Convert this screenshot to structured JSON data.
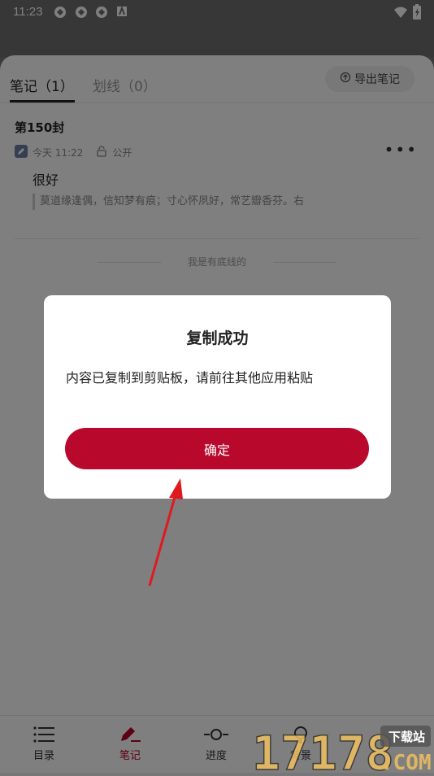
{
  "status": {
    "time": "11:23"
  },
  "tabs": [
    {
      "label": "笔记（1）",
      "active": true
    },
    {
      "label": "划线（0）",
      "active": false
    }
  ],
  "export_label": "导出笔记",
  "note": {
    "title": "第150封",
    "time": "今天 11:22",
    "visibility": "公开",
    "comment": "很好",
    "quote": "莫道缘逢偶，信知梦有痕；寸心怀夙好，常艺瓣香芬。右"
  },
  "bottom_line": "我是有底线的",
  "bottom_nav": [
    {
      "label": "目录",
      "icon": "list-icon"
    },
    {
      "label": "笔记",
      "icon": "pen-icon",
      "active": true
    },
    {
      "label": "进度",
      "icon": "progress-icon"
    },
    {
      "label": "背景",
      "icon": "theme-icon"
    }
  ],
  "dialog": {
    "title": "复制成功",
    "message": "内容已复制到剪贴板，请前往其他应用粘贴",
    "confirm": "确定"
  },
  "watermark": {
    "text": "17178",
    "sub": "下载站",
    "suffix": ".COM"
  },
  "colors": {
    "accent": "#b8092d",
    "arrow": "#e0191f"
  }
}
